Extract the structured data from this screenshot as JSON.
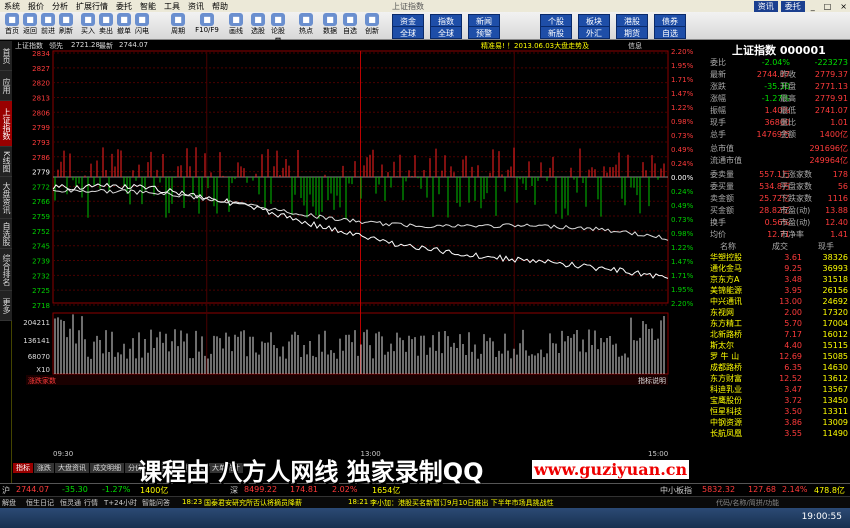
{
  "menu": {
    "items": [
      "系统",
      "报价",
      "分析",
      "扩展行情",
      "委托",
      "智能",
      "工具",
      "资讯",
      "帮助"
    ],
    "title": "上证指数",
    "right": [
      "资讯",
      "委托"
    ]
  },
  "toolbar": {
    "buttons": [
      "首页",
      "返回",
      "前进",
      "刷新",
      "买入",
      "卖出",
      "撤单",
      "闪电",
      "周期",
      "F10/F9",
      "画线",
      "选股",
      "论股堂",
      "热点",
      "数据",
      "自选",
      "创新"
    ],
    "blue_buttons": [
      "资金",
      "全球",
      "指数",
      "全球",
      "新闻",
      "预警",
      "个股",
      "新股",
      "板块",
      "外汇",
      "港股",
      "期货",
      "债券",
      "自选"
    ]
  },
  "side_tabs": [
    "首页",
    "应用",
    "上证指数",
    "K线图",
    "大盘资讯",
    "自选股",
    "综合排名",
    "更多"
  ],
  "chart_header": {
    "name": "上证指数",
    "prev_label": "领先",
    "price_line": "2721.28",
    "latest_label": "最新",
    "latest": "2744.07",
    "news": "精准易! ！2013.06.03大盘走势及",
    "info_btn": "信息"
  },
  "y_left": [
    "2834",
    "2827",
    "2820",
    "2813",
    "2806",
    "2799",
    "2793",
    "2786",
    "2779",
    "2772",
    "2766",
    "2759",
    "2752",
    "2745",
    "2739",
    "2732",
    "2725",
    "2718"
  ],
  "y_right": [
    "2.20%",
    "1.95%",
    "1.71%",
    "1.47%",
    "1.22%",
    "0.98%",
    "0.73%",
    "0.49%",
    "0.24%",
    "0.00%",
    "0.24%",
    "0.49%",
    "0.73%",
    "0.98%",
    "1.22%",
    "1.47%",
    "1.71%",
    "1.95%",
    "2.20%"
  ],
  "vol_labels": [
    "204211",
    "136141",
    "68070",
    "X10"
  ],
  "time_labels": [
    "09:30",
    "13:00",
    "15:00"
  ],
  "bottom_bar": {
    "left": "涨跌家数",
    "right": "指标说明"
  },
  "bottom_tabs": [
    "指标",
    "涨跌",
    "大盘资讯",
    "成交明细",
    "分价表",
    "资金",
    "分时成交",
    "大单统计"
  ],
  "quote": {
    "title": "上证指数 000001",
    "rows": [
      {
        "l": "委比",
        "v": "-2.04%",
        "l2": "",
        "v2": "-223273"
      },
      {
        "l": "最新",
        "v": "2744.07",
        "l2": "昨收",
        "v2": "2779.37"
      },
      {
        "l": "涨跌",
        "v": "-35.30",
        "l2": "开盘",
        "v2": "2771.13"
      },
      {
        "l": "涨幅",
        "v": "-1.27%",
        "l2": "最高",
        "v2": "2779.91"
      },
      {
        "l": "振幅",
        "v": "1.40%",
        "l2": "最低",
        "v2": "2741.07"
      },
      {
        "l": "现手",
        "v": "36800",
        "l2": "量比",
        "v2": "1.01"
      },
      {
        "l": "总手",
        "v": "14769万",
        "l2": "金额",
        "v2": "1400亿"
      }
    ],
    "rows2": [
      {
        "l": "总市值",
        "v": "291696亿"
      },
      {
        "l": "流通市值",
        "v": "249964亿"
      }
    ],
    "rows3": [
      {
        "l": "委卖量",
        "v": "557.1万",
        "l2": "上涨家数",
        "v2": "178"
      },
      {
        "l": "委买量",
        "v": "534.8万",
        "l2": "平盘家数",
        "v2": "56"
      },
      {
        "l": "卖金额",
        "v": "25.72亿",
        "l2": "下跌家数",
        "v2": "1116"
      },
      {
        "l": "买金额",
        "v": "28.82亿",
        "l2": "市盈(动)",
        "v2": "13.88"
      },
      {
        "l": "换手",
        "v": "0.56%",
        "l2": "市盈(动)",
        "v2": "12.40"
      },
      {
        "l": "均价",
        "v": "12.71",
        "l2": "市净率",
        "v2": "1.41"
      }
    ],
    "list_header": {
      "c1": "名称",
      "c2": "成交",
      "c3": "现手"
    },
    "list": [
      {
        "n": "华塑控股",
        "p": "3.61",
        "h": "38326"
      },
      {
        "n": "通化金马",
        "p": "9.25",
        "h": "36993"
      },
      {
        "n": "京东方A",
        "p": "3.48",
        "h": "31518"
      },
      {
        "n": "美锦能源",
        "p": "3.95",
        "h": "26156"
      },
      {
        "n": "中兴通讯",
        "p": "13.00",
        "h": "24692"
      },
      {
        "n": "东视网",
        "p": "2.00",
        "h": "17320"
      },
      {
        "n": "东方精工",
        "p": "5.70",
        "h": "17004"
      },
      {
        "n": "北新路桥",
        "p": "7.17",
        "h": "16012"
      },
      {
        "n": "斯太尔",
        "p": "4.40",
        "h": "15115"
      },
      {
        "n": "罗 牛 山",
        "p": "12.69",
        "h": "15085"
      },
      {
        "n": "成都路桥",
        "p": "6.35",
        "h": "14630"
      },
      {
        "n": "东方财富",
        "p": "12.52",
        "h": "13612"
      },
      {
        "n": "科迪乳业",
        "p": "3.47",
        "h": "13567"
      },
      {
        "n": "宝鹰股份",
        "p": "3.72",
        "h": "13450"
      },
      {
        "n": "恒星科技",
        "p": "3.50",
        "h": "13311"
      },
      {
        "n": "中钢资源",
        "p": "3.86",
        "h": "13009"
      },
      {
        "n": "长航凤凰",
        "p": "3.55",
        "h": "11490"
      }
    ]
  },
  "status1": {
    "a": "沪",
    "b": "2744.07",
    "c": "-35.30",
    "d": "-1.27%",
    "e": "1400亿",
    "f": "深",
    "g": "8499.22",
    "h": "174.81",
    "i": "2.02%",
    "j": "1654亿",
    "k": "中小板指",
    "l": "5832.32",
    "m": "127.68",
    "n": "2.14%",
    "o": "478.8亿"
  },
  "status2": {
    "a": "解盘",
    "b": "恒生日记",
    "c": "恒灵通",
    "d": "行情",
    "e": "T+24小时",
    "f": "智能问答",
    "g": "18:23",
    "h": "国泰君安研究所否认将摘员降薪",
    "i": "18:21",
    "j": "李小加：港股买名新暂订9月10日推出 下半年市场具挑战性",
    "k": "代码/名称/简拼/功能"
  },
  "taskbar": {
    "clock": "19:00:55"
  },
  "overlay": {
    "watermark": "课程由 八方人网线 独家录制QQ",
    "url": "www.guziyuan.cn"
  }
}
